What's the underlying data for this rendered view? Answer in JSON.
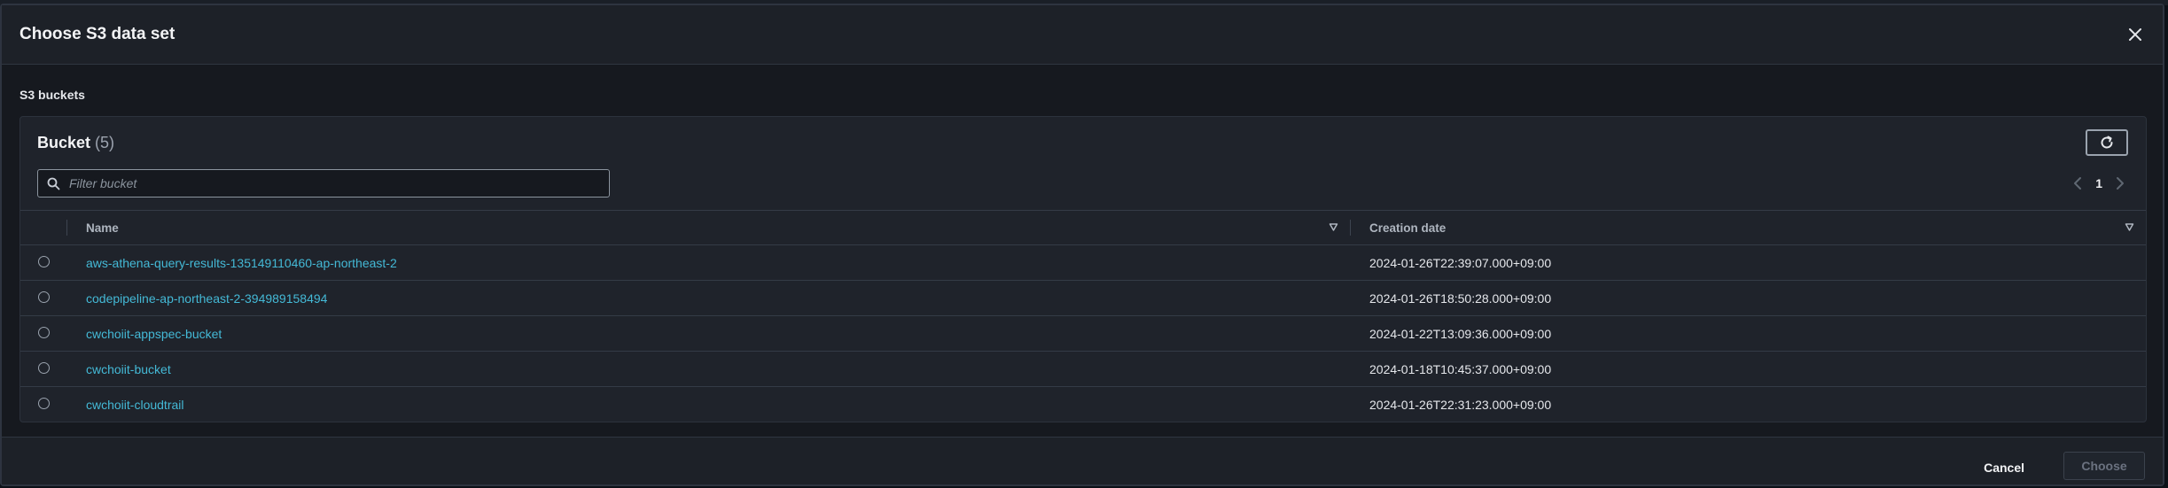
{
  "modal": {
    "title": "Choose S3 data set",
    "section_label": "S3 buckets"
  },
  "container": {
    "title": "Bucket",
    "count": "(5)",
    "filter_placeholder": "Filter bucket",
    "page_number": "1"
  },
  "table": {
    "columns": [
      "Name",
      "Creation date"
    ],
    "rows": [
      {
        "name": "aws-athena-query-results-135149110460-ap-northeast-2",
        "creation_date": "2024-01-26T22:39:07.000+09:00"
      },
      {
        "name": "codepipeline-ap-northeast-2-394989158494",
        "creation_date": "2024-01-26T18:50:28.000+09:00"
      },
      {
        "name": "cwchoiit-appspec-bucket",
        "creation_date": "2024-01-22T13:09:36.000+09:00"
      },
      {
        "name": "cwchoiit-bucket",
        "creation_date": "2024-01-18T10:45:37.000+09:00"
      },
      {
        "name": "cwchoiit-cloudtrail",
        "creation_date": "2024-01-26T22:31:23.000+09:00"
      }
    ]
  },
  "footer": {
    "cancel_label": "Cancel",
    "choose_label": "Choose"
  },
  "icons": {
    "close": "close-icon",
    "refresh": "refresh-icon",
    "search": "search-icon",
    "prev": "chevron-left-icon",
    "next": "chevron-right-icon",
    "sort": "sort-caret-icon"
  },
  "colors": {
    "link": "#44b9d6",
    "background": "#16191f",
    "panel": "#1f232b"
  }
}
